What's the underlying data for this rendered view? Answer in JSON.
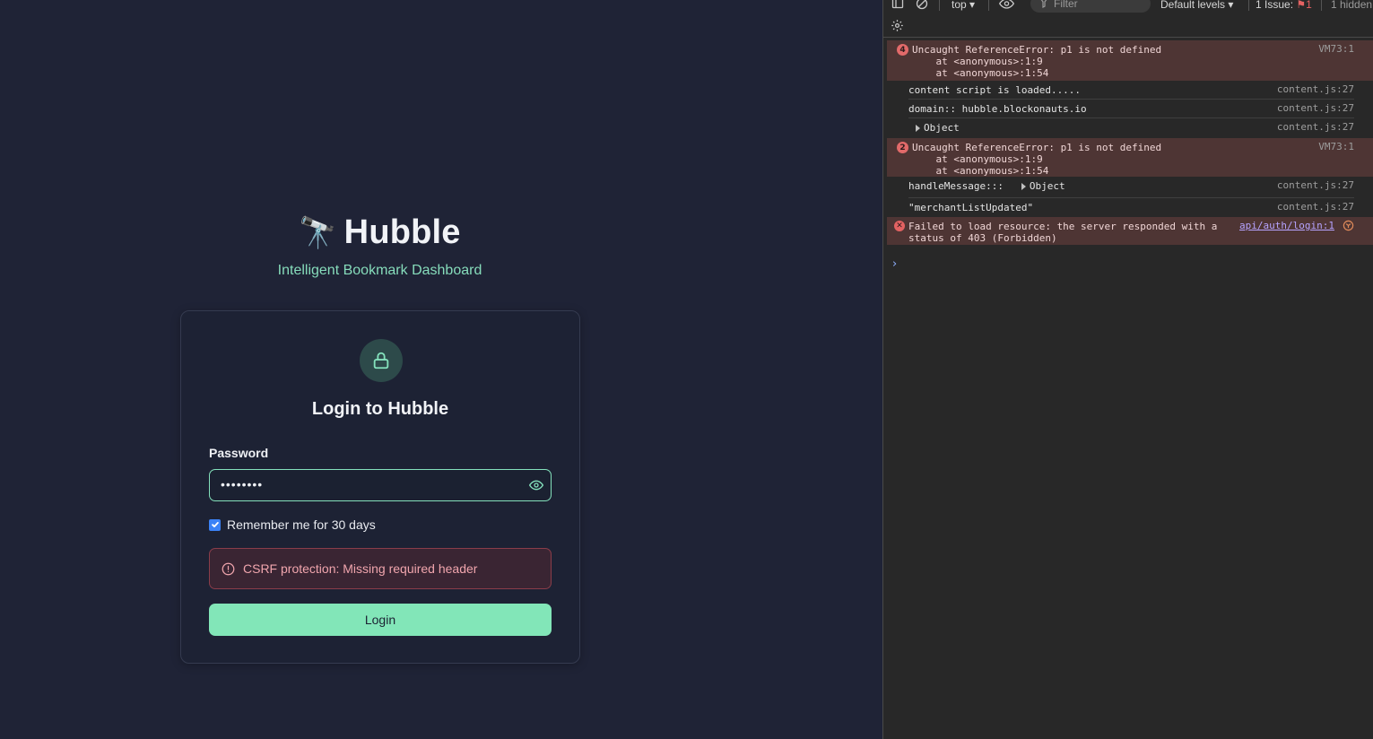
{
  "app": {
    "brand_emoji": "🔭",
    "brand_title": "Hubble",
    "subtitle": "Intelligent Bookmark Dashboard",
    "card_title": "Login to Hubble",
    "password_label": "Password",
    "password_value": "••••••••",
    "remember_label": "Remember me for 30 days",
    "remember_checked": true,
    "error_message": "CSRF protection: Missing required header",
    "login_button": "Login",
    "colors": {
      "accent": "#82e6b8",
      "background": "#1f2336",
      "error": "#f0a5ad"
    }
  },
  "devtools": {
    "toolbar": {
      "context": "top",
      "filter_placeholder": "Filter",
      "levels": "Default levels",
      "issues_label": "1 Issue:",
      "issues_count": "1",
      "hidden": "1 hidden"
    },
    "messages": [
      {
        "type": "error",
        "count": "4",
        "lines": "Uncaught ReferenceError: p1 is not defined\n    at <anonymous>:1:9\n    at <anonymous>:1:54",
        "source": "VM73:1"
      },
      {
        "type": "log",
        "lines": "content script is loaded.....",
        "source": "content.js:27"
      },
      {
        "type": "log",
        "lines": "domain:: hubble.blockonauts.io",
        "source": "content.js:27"
      },
      {
        "type": "object",
        "lines": "Object",
        "source": "content.js:27"
      },
      {
        "type": "error",
        "count": "2",
        "lines": "Uncaught ReferenceError: p1 is not defined\n    at <anonymous>:1:9\n    at <anonymous>:1:54",
        "source": "VM73:1"
      },
      {
        "type": "log-object",
        "lines": "handleMessage:::",
        "object": "Object",
        "source": "content.js:27"
      },
      {
        "type": "log",
        "lines": "\"merchantListUpdated\"",
        "source": "content.js:27"
      },
      {
        "type": "network-error",
        "lines": "Failed to load resource: the server responded with a\nstatus of 403 (Forbidden)",
        "source": "api/auth/login:1"
      }
    ],
    "prompt_symbol": "›"
  }
}
